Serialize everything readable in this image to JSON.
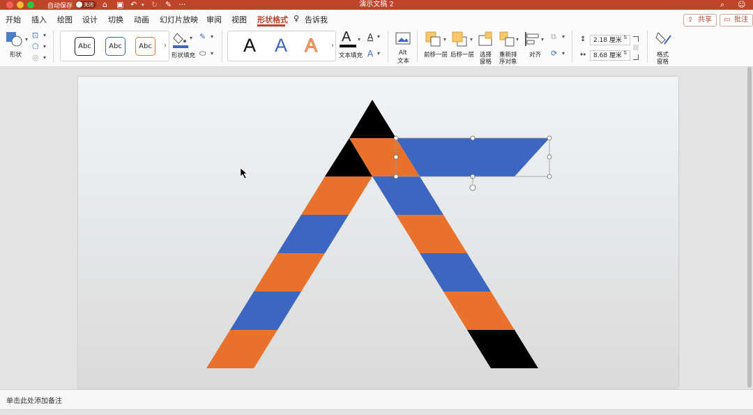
{
  "titlebar": {
    "autosave_label": "自动保存",
    "autosave_state": "关闭",
    "document_title": "演示文稿 2",
    "more": "···"
  },
  "tabs": {
    "items": [
      {
        "label": "开始"
      },
      {
        "label": "插入"
      },
      {
        "label": "绘图"
      },
      {
        "label": "设计"
      },
      {
        "label": "切换"
      },
      {
        "label": "动画"
      },
      {
        "label": "幻灯片放映"
      },
      {
        "label": "审阅"
      },
      {
        "label": "视图"
      },
      {
        "label": "形状格式",
        "active": true
      }
    ],
    "tell_me": "告诉我",
    "share": "共享",
    "comments": "批注"
  },
  "ribbon": {
    "shape_label": "形状",
    "style_sample": "Abc",
    "shape_fill_label": "形状填充",
    "text_fill_label": "文本填充",
    "wordart_letter": "A",
    "alt_text_label_1": "Alt",
    "alt_text_label_2": "文本",
    "bring_forward": "前移一层",
    "send_backward": "后移一层",
    "selection_pane_1": "选择",
    "selection_pane_2": "窗格",
    "reorder_1": "重新排",
    "reorder_2": "序对象",
    "align": "对齐",
    "height_value": "2.18 厘米",
    "width_value": "8.68 厘米",
    "format_pane_1": "格式",
    "format_pane_2": "窗格"
  },
  "colors": {
    "accent": "#c0442a",
    "orange": "#e8722c",
    "blue": "#3d66c0",
    "black": "#000000"
  },
  "notes": {
    "placeholder": "单击此处添加备注"
  }
}
